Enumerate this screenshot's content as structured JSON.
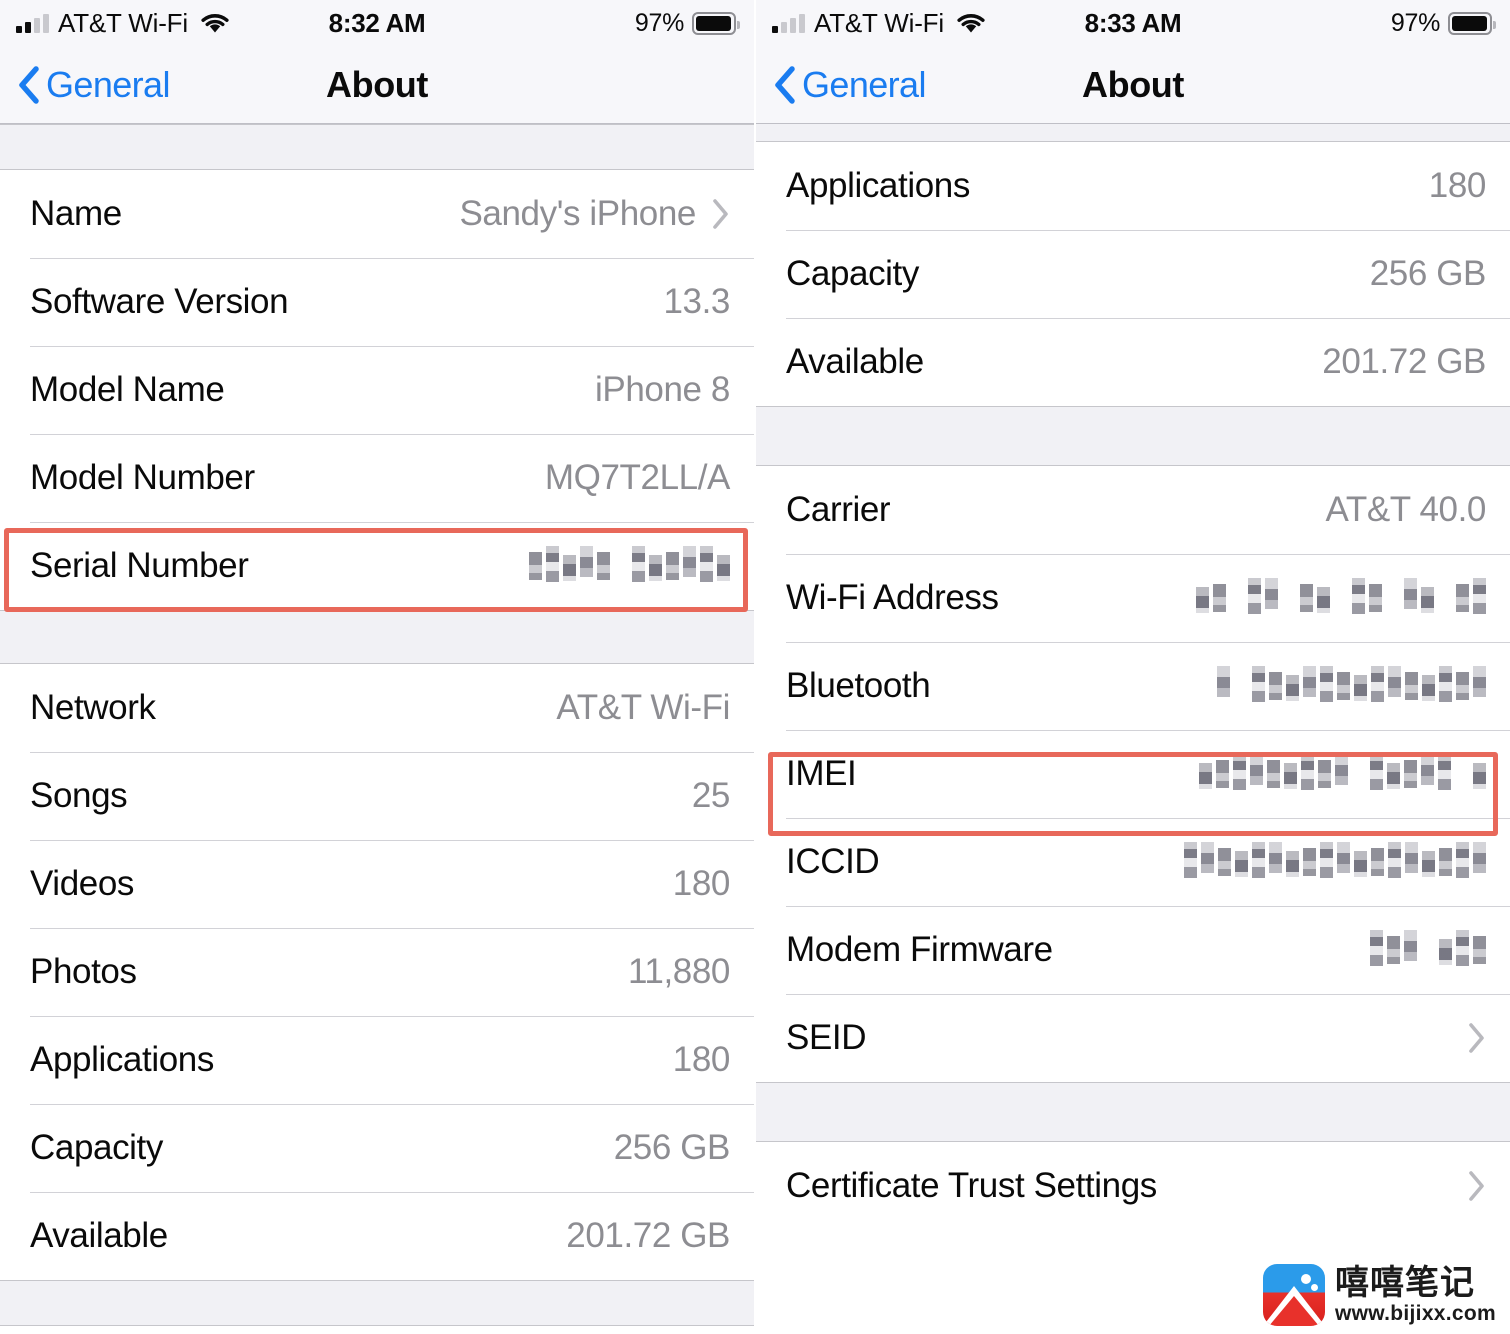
{
  "panels": [
    {
      "id": "left",
      "status_bar": {
        "carrier": "AT&T Wi-Fi",
        "time": "8:32 AM",
        "battery_percent": "97%",
        "signal_bars_filled": 2,
        "signal_bars_total": 4,
        "wifi_icon": "wifi-icon",
        "battery_icon": "battery-icon"
      },
      "nav": {
        "back_label": "General",
        "back_icon": "chevron-left-icon",
        "title": "About"
      },
      "sections": [
        {
          "rows": [
            {
              "label": "Name",
              "value": "Sandy's iPhone",
              "chevron": true,
              "redacted": false
            },
            {
              "label": "Software Version",
              "value": "13.3",
              "chevron": false,
              "redacted": false
            },
            {
              "label": "Model Name",
              "value": "iPhone 8",
              "chevron": false,
              "redacted": false
            },
            {
              "label": "Model Number",
              "value": "MQ7T2LL/A",
              "chevron": false,
              "redacted": false
            },
            {
              "label": "Serial Number",
              "value": "",
              "chevron": false,
              "redacted": true,
              "highlight": true
            }
          ]
        },
        {
          "rows": [
            {
              "label": "Network",
              "value": "AT&T Wi-Fi",
              "chevron": false,
              "redacted": false
            },
            {
              "label": "Songs",
              "value": "25",
              "chevron": false,
              "redacted": false
            },
            {
              "label": "Videos",
              "value": "180",
              "chevron": false,
              "redacted": false
            },
            {
              "label": "Photos",
              "value": "11,880",
              "chevron": false,
              "redacted": false
            },
            {
              "label": "Applications",
              "value": "180",
              "chevron": false,
              "redacted": false
            },
            {
              "label": "Capacity",
              "value": "256 GB",
              "chevron": false,
              "redacted": false
            },
            {
              "label": "Available",
              "value": "201.72 GB",
              "chevron": false,
              "redacted": false
            }
          ]
        }
      ]
    },
    {
      "id": "right",
      "status_bar": {
        "carrier": "AT&T Wi-Fi",
        "time": "8:33 AM",
        "battery_percent": "97%",
        "signal_bars_filled": 1,
        "signal_bars_total": 4,
        "wifi_icon": "wifi-icon",
        "battery_icon": "battery-icon"
      },
      "nav": {
        "back_label": "General",
        "back_icon": "chevron-left-icon",
        "title": "About"
      },
      "sections": [
        {
          "rows": [
            {
              "label": "Applications",
              "value": "180",
              "chevron": false,
              "redacted": false
            },
            {
              "label": "Capacity",
              "value": "256 GB",
              "chevron": false,
              "redacted": false
            },
            {
              "label": "Available",
              "value": "201.72 GB",
              "chevron": false,
              "redacted": false
            }
          ]
        },
        {
          "rows": [
            {
              "label": "Carrier",
              "value": "AT&T 40.0",
              "chevron": false,
              "redacted": false
            },
            {
              "label": "Wi-Fi Address",
              "value": "",
              "chevron": false,
              "redacted": true
            },
            {
              "label": "Bluetooth",
              "value": "",
              "chevron": false,
              "redacted": true
            },
            {
              "label": "IMEI",
              "value": "",
              "chevron": false,
              "redacted": true,
              "highlight": true
            },
            {
              "label": "ICCID",
              "value": "",
              "chevron": false,
              "redacted": true
            },
            {
              "label": "Modem Firmware",
              "value": "",
              "chevron": false,
              "redacted": true
            },
            {
              "label": "SEID",
              "value": "",
              "chevron": true,
              "redacted": false
            }
          ]
        },
        {
          "rows": [
            {
              "label": "Certificate Trust Settings",
              "value": "",
              "chevron": true,
              "redacted": false
            }
          ]
        }
      ]
    }
  ],
  "watermark": {
    "site_name_cn": "嘻嘻笔记",
    "url": "www.bijixx.com",
    "logo_icon": "mountain-logo-icon"
  },
  "colors": {
    "accent_blue": "#1a7cf0",
    "highlight_red": "#e8685a",
    "value_gray": "#8d8d92",
    "section_gap": "#f1f1f5",
    "bar_background": "#f7f7fa"
  }
}
